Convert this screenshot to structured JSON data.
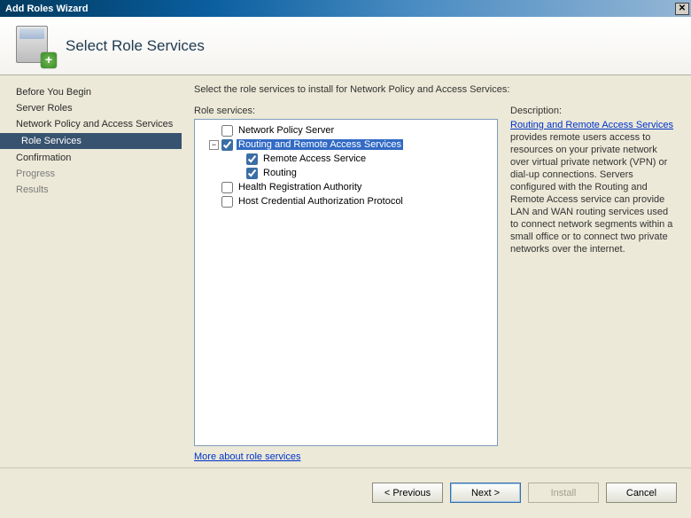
{
  "titlebar": {
    "title": "Add Roles Wizard"
  },
  "header": {
    "title": "Select Role Services"
  },
  "nav": {
    "items": [
      {
        "label": "Before You Begin",
        "active": false
      },
      {
        "label": "Server Roles",
        "active": false
      },
      {
        "label": "Network Policy and Access Services",
        "active": false
      },
      {
        "label": "Role Services",
        "active": true
      },
      {
        "label": "Confirmation",
        "active": false
      },
      {
        "label": "Progress",
        "active": false,
        "dim": true
      },
      {
        "label": "Results",
        "active": false,
        "dim": true
      }
    ]
  },
  "content": {
    "instruction": "Select the role services to install for Network Policy and Access Services:",
    "role_services_label": "Role services:",
    "more_link": "More about role services"
  },
  "tree": {
    "items": [
      {
        "label": "Network Policy Server",
        "level": 0,
        "checked": false,
        "expander": "none",
        "selected": false
      },
      {
        "label": "Routing and Remote Access Services",
        "level": 0,
        "checked": true,
        "expander": "minus",
        "selected": true
      },
      {
        "label": "Remote Access Service",
        "level": 1,
        "checked": true,
        "expander": "none",
        "selected": false
      },
      {
        "label": "Routing",
        "level": 1,
        "checked": true,
        "expander": "none",
        "selected": false
      },
      {
        "label": "Health Registration Authority",
        "level": 0,
        "checked": false,
        "expander": "none",
        "selected": false
      },
      {
        "label": "Host Credential Authorization Protocol",
        "level": 0,
        "checked": false,
        "expander": "none",
        "selected": false
      }
    ]
  },
  "description": {
    "label": "Description:",
    "link_text": "Routing and Remote Access Services",
    "body": " provides remote users access to resources on your private network over virtual private network (VPN) or dial-up connections. Servers configured with the Routing and Remote Access service can provide LAN and WAN routing services used to connect network segments within a small office or to connect two private networks over the internet."
  },
  "buttons": {
    "previous": "< Previous",
    "next": "Next >",
    "install": "Install",
    "cancel": "Cancel"
  }
}
